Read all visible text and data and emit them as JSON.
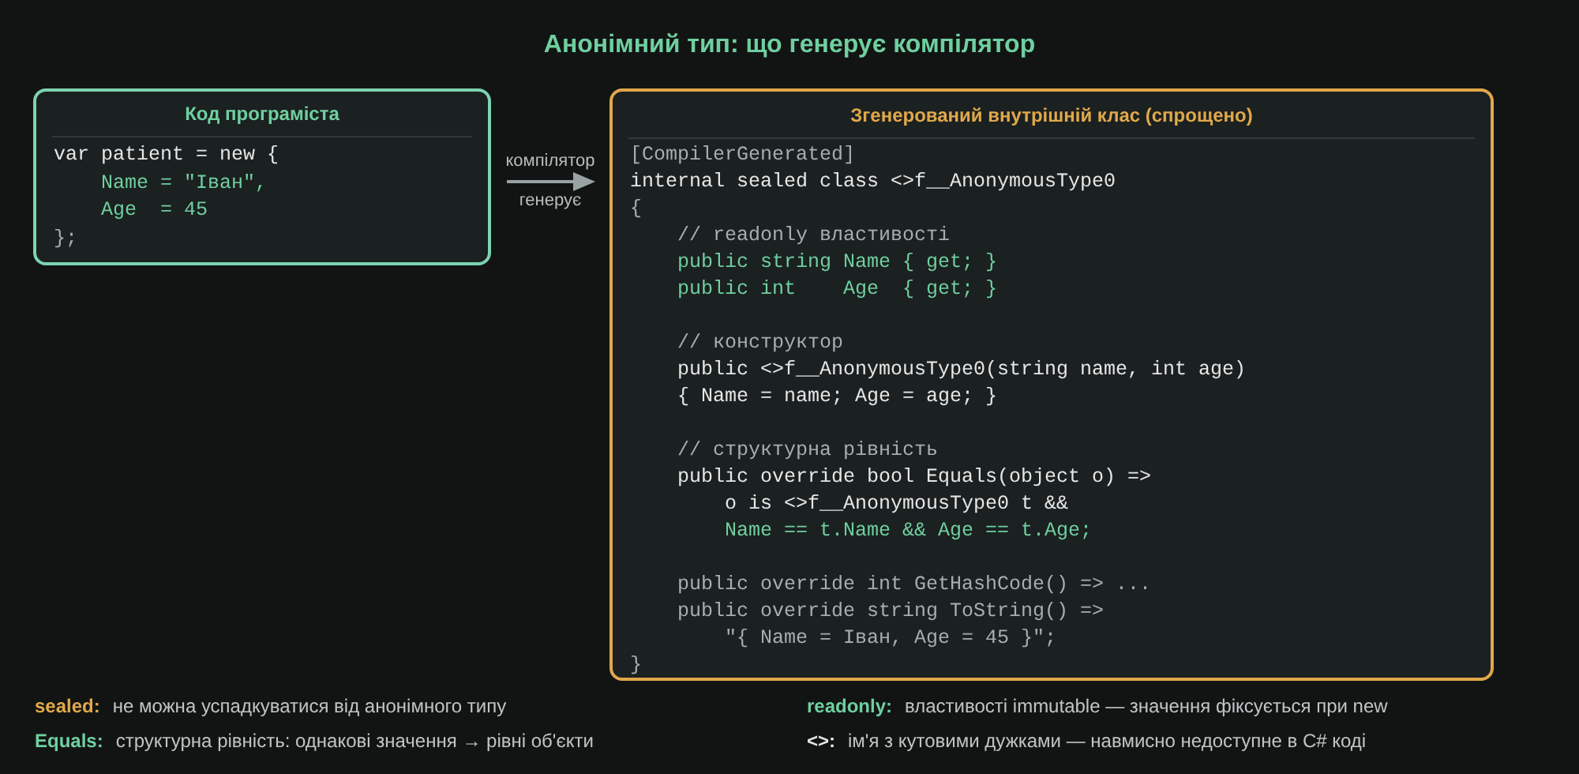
{
  "title": "Анонімний тип: що генерує компілятор",
  "source_panel": {
    "title": "Код програміста",
    "lines": [
      {
        "text": "var patient = new {",
        "kind": "plain"
      },
      {
        "text": "    Name = \"Іван\",",
        "kind": "green"
      },
      {
        "text": "    Age  = 45",
        "kind": "green"
      },
      {
        "text": "};",
        "kind": "dim"
      }
    ]
  },
  "arrow": {
    "label_top": "компілятор",
    "label_bottom": "генерує"
  },
  "generated_panel": {
    "title": "Згенерований внутрішній клас (спрощено)",
    "lines": [
      {
        "text": "[CompilerGenerated]",
        "kind": "dim"
      },
      {
        "text": "internal sealed class <>f__AnonymousType0",
        "kind": "plain"
      },
      {
        "text": "{",
        "kind": "dim"
      },
      {
        "text": "    // readonly властивості",
        "kind": "dim"
      },
      {
        "text": "    public string Name { get; }",
        "kind": "green"
      },
      {
        "text": "    public int    Age  { get; }",
        "kind": "green"
      },
      {
        "kind": "blank"
      },
      {
        "text": "    // конструктор",
        "kind": "dim"
      },
      {
        "text": "    public <>f__AnonymousType0(string name, int age)",
        "kind": "plain"
      },
      {
        "text": "    { Name = name; Age = age; }",
        "kind": "plain"
      },
      {
        "kind": "blank"
      },
      {
        "text": "    // структурна рівність",
        "kind": "dim"
      },
      {
        "text": "    public override bool Equals(object o) =>",
        "kind": "plain"
      },
      {
        "text": "        o is <>f__AnonymousType0 t &&",
        "kind": "plain"
      },
      {
        "text": "        Name == t.Name && Age == t.Age;",
        "kind": "green"
      },
      {
        "kind": "blank"
      },
      {
        "text": "    public override int GetHashCode() => ...",
        "kind": "dim"
      },
      {
        "text": "    public override string ToString() =>",
        "kind": "dim"
      },
      {
        "text": "        \"{ Name = Іван, Age = 45 }\";",
        "kind": "dim"
      },
      {
        "text": "}",
        "kind": "dim"
      }
    ]
  },
  "legend": [
    {
      "term": "sealed:",
      "text": "не можна успадкуватися від анонімного типу",
      "color": "#e0a84a"
    },
    {
      "term": "readonly:",
      "text": "властивості immutable — значення фіксується при new",
      "color": "#6fcf9f"
    },
    {
      "term": "Equals:",
      "text": "структурна рівність: однакові значення → рівні об'єкти",
      "color": "#6fcf9f"
    },
    {
      "term": "<>:",
      "text": "ім'я з кутовими дужками — навмисно недоступне в C# коді",
      "color": "#e6e6e6"
    }
  ]
}
